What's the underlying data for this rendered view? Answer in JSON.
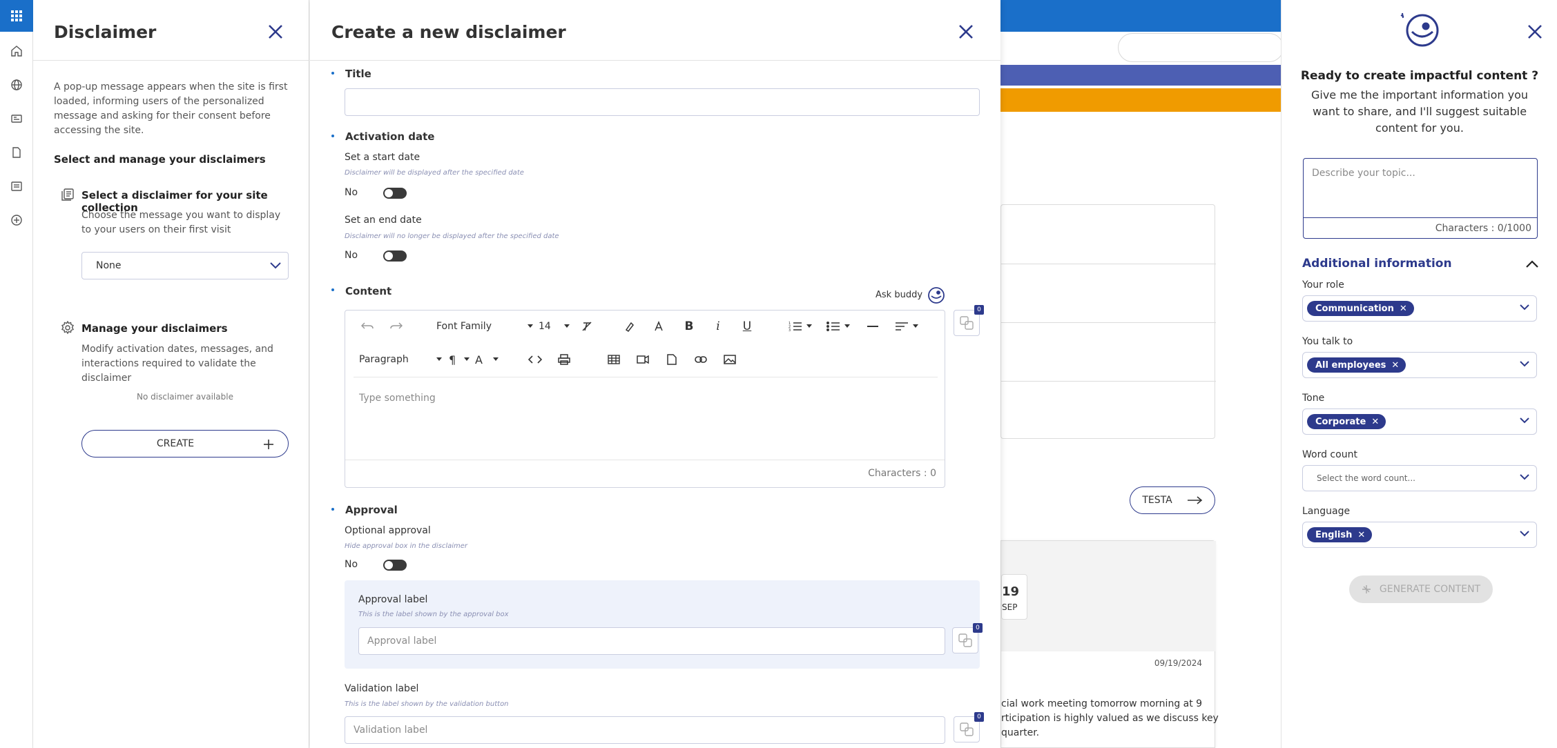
{
  "nav": {
    "items": [
      {
        "name": "apps-grid-icon"
      },
      {
        "name": "home-icon"
      },
      {
        "name": "globe-icon"
      },
      {
        "name": "news-icon"
      },
      {
        "name": "document-icon"
      },
      {
        "name": "list-icon"
      },
      {
        "name": "add-circle-icon"
      }
    ]
  },
  "disclaimer": {
    "title": "Disclaimer",
    "intro": "A pop-up message appears when the site is first loaded, informing users of the personalized message and asking for their consent before accessing the site.",
    "select_manage": "Select and manage your disclaimers",
    "select_title": "Select a disclaimer for your site collection",
    "select_desc": "Choose the message you want to display to your users on their first visit",
    "dropdown_value": "None",
    "manage_title": "Manage your disclaimers",
    "manage_desc": "Modify activation dates, messages, and interactions required to validate the disclaimer",
    "empty": "No disclaimer available",
    "create_label": "CREATE"
  },
  "create": {
    "title": "Create a new disclaimer",
    "title_label": "Title",
    "activation_label": "Activation date",
    "start_label": "Set a start date",
    "start_hint": "Disclaimer will be displayed after the specified date",
    "start_value": "No",
    "end_label": "Set an end date",
    "end_hint": "Disclaimer will no longer be displayed after the specified date",
    "end_value": "No",
    "content_label": "Content",
    "ask_buddy": "Ask buddy",
    "editor": {
      "font_family": "Font Family",
      "font_size": "14",
      "paragraph": "Paragraph",
      "placeholder": "Type something",
      "chars": "Characters : 0",
      "badge": "0"
    },
    "approval_label": "Approval",
    "optional_label": "Optional approval",
    "optional_hint": "Hide approval box in the disclaimer",
    "optional_value": "No",
    "approval_box_label": "Approval label",
    "approval_box_hint": "This is the label shown by the approval box",
    "approval_placeholder": "Approval label",
    "approval_badge": "0",
    "validation_label": "Validation label",
    "validation_hint": "This is the label shown by the validation button",
    "validation_placeholder": "Validation label",
    "validation_badge": "0"
  },
  "background": {
    "testa_label": "TESTA",
    "date_day": "19",
    "date_month": "SEP",
    "post_date": "09/19/2024",
    "snippet_1": "cial work meeting tomorrow morning at 9",
    "snippet_2": "rticipation is highly valued as we discuss key",
    "snippet_3": "quarter.",
    "colors": {
      "blue": "#1a6fc9",
      "indigo": "#4d5fb3",
      "orange": "#f09b00"
    }
  },
  "ai": {
    "headline": "Ready to create impactful content ?",
    "subtitle": "Give me the important information you want to share, and I'll suggest suitable content for you.",
    "topic_placeholder": "Describe your topic...",
    "topic_chars": "Characters : 0/1000",
    "additional": "Additional information",
    "role_label": "Your role",
    "role_chip": "Communication",
    "talk_label": "You talk to",
    "talk_chip": "All employees",
    "tone_label": "Tone",
    "tone_chip": "Corporate",
    "wordcount_label": "Word count",
    "wordcount_placeholder": "Select the word count...",
    "language_label": "Language",
    "language_chip": "English",
    "generate_label": "GENERATE CONTENT"
  }
}
